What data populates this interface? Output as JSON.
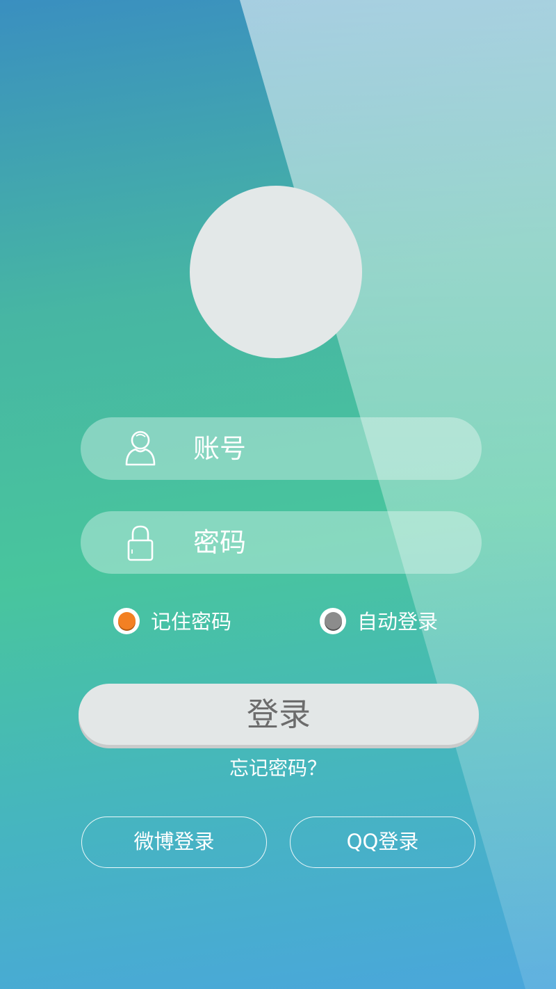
{
  "login_form": {
    "account_placeholder": "账号",
    "password_placeholder": "密码",
    "remember_password": {
      "label": "记住密码",
      "checked": true
    },
    "auto_login": {
      "label": "自动登录",
      "checked": false
    },
    "login_button": "登录",
    "forgot_password": "忘记密码？"
  },
  "social_login": {
    "weibo": "微博登录",
    "qq": "QQ登录"
  },
  "colors": {
    "selected_radio": "#f38023",
    "unselected_radio": "#8c8c8c",
    "button_bg": "#e3e7e7",
    "button_text": "#6c6c6c"
  },
  "icons": {
    "account": "user-icon",
    "password": "lock-icon"
  }
}
